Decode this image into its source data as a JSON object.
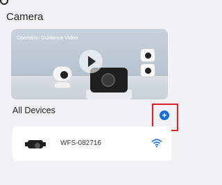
{
  "page": {
    "title": "Camera"
  },
  "banner": {
    "caption": "Operation Guidance Video"
  },
  "devices_section": {
    "title": "All Devices"
  },
  "devices": [
    {
      "name": "WFS-082716"
    }
  ],
  "colors": {
    "accent": "#1a6fdc",
    "highlight": "#e02020",
    "wifi": "#1a6fdc"
  },
  "icons": {
    "add": "plus-icon",
    "wifi": "wifi-icon",
    "play": "play-icon"
  }
}
